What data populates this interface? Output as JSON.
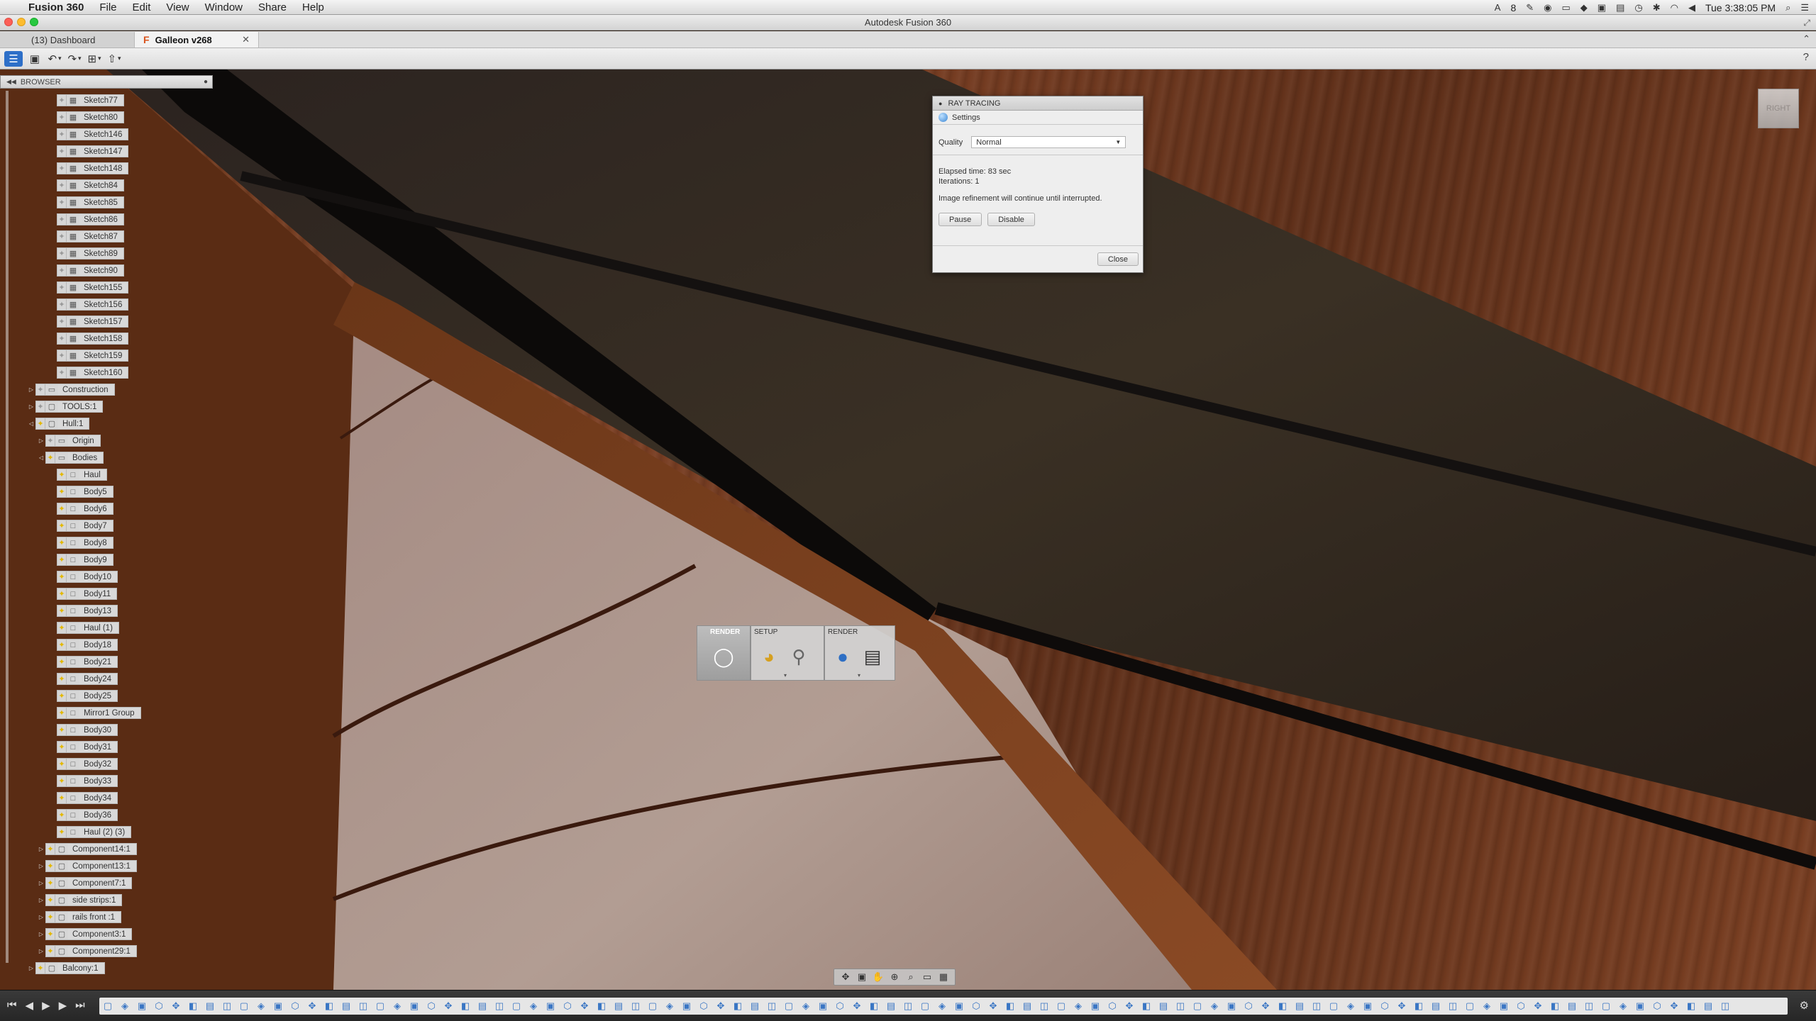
{
  "menubar": {
    "app_name": "Fusion 360",
    "items": [
      "File",
      "Edit",
      "View",
      "Window",
      "Share",
      "Help"
    ],
    "status": {
      "badge": "8",
      "clock": "Tue 3:38:05 PM"
    }
  },
  "window": {
    "title": "Autodesk Fusion 360"
  },
  "tabs": [
    {
      "label": "(13) Dashboard"
    },
    {
      "label": "Galleon v268"
    }
  ],
  "browser": {
    "title": "BROWSER",
    "nodes": [
      {
        "label": "Sketch77",
        "indent": 3,
        "type": "sketch",
        "bulb": "off"
      },
      {
        "label": "Sketch80",
        "indent": 3,
        "type": "sketch",
        "bulb": "off"
      },
      {
        "label": "Sketch146",
        "indent": 3,
        "type": "sketch",
        "bulb": "off"
      },
      {
        "label": "Sketch147",
        "indent": 3,
        "type": "sketch",
        "bulb": "off"
      },
      {
        "label": "Sketch148",
        "indent": 3,
        "type": "sketch",
        "bulb": "off"
      },
      {
        "label": "Sketch84",
        "indent": 3,
        "type": "sketch",
        "bulb": "off"
      },
      {
        "label": "Sketch85",
        "indent": 3,
        "type": "sketch",
        "bulb": "off"
      },
      {
        "label": "Sketch86",
        "indent": 3,
        "type": "sketch",
        "bulb": "off"
      },
      {
        "label": "Sketch87",
        "indent": 3,
        "type": "sketch",
        "bulb": "off"
      },
      {
        "label": "Sketch89",
        "indent": 3,
        "type": "sketch",
        "bulb": "off"
      },
      {
        "label": "Sketch90",
        "indent": 3,
        "type": "sketch",
        "bulb": "off"
      },
      {
        "label": "Sketch155",
        "indent": 3,
        "type": "sketch",
        "bulb": "off"
      },
      {
        "label": "Sketch156",
        "indent": 3,
        "type": "sketch",
        "bulb": "off"
      },
      {
        "label": "Sketch157",
        "indent": 3,
        "type": "sketch",
        "bulb": "off"
      },
      {
        "label": "Sketch158",
        "indent": 3,
        "type": "sketch",
        "bulb": "off"
      },
      {
        "label": "Sketch159",
        "indent": 3,
        "type": "sketch",
        "bulb": "off"
      },
      {
        "label": "Sketch160",
        "indent": 3,
        "type": "sketch",
        "bulb": "off"
      },
      {
        "label": "Construction",
        "indent": 1,
        "type": "folder",
        "bulb": "off",
        "expander": "▷"
      },
      {
        "label": "TOOLS:1",
        "indent": 1,
        "type": "component",
        "bulb": "off",
        "expander": "▷"
      },
      {
        "label": "Hull:1",
        "indent": 1,
        "type": "component",
        "bulb": "on",
        "expander": "◁"
      },
      {
        "label": "Origin",
        "indent": 2,
        "type": "folder",
        "bulb": "off",
        "expander": "▷"
      },
      {
        "label": "Bodies",
        "indent": 2,
        "type": "folder",
        "bulb": "on",
        "expander": "◁"
      },
      {
        "label": "Haul",
        "indent": 3,
        "type": "body",
        "bulb": "on"
      },
      {
        "label": "Body5",
        "indent": 3,
        "type": "body",
        "bulb": "on"
      },
      {
        "label": "Body6",
        "indent": 3,
        "type": "body",
        "bulb": "on"
      },
      {
        "label": "Body7",
        "indent": 3,
        "type": "body",
        "bulb": "on"
      },
      {
        "label": "Body8",
        "indent": 3,
        "type": "body",
        "bulb": "on"
      },
      {
        "label": "Body9",
        "indent": 3,
        "type": "body",
        "bulb": "on"
      },
      {
        "label": "Body10",
        "indent": 3,
        "type": "body",
        "bulb": "on"
      },
      {
        "label": "Body11",
        "indent": 3,
        "type": "body",
        "bulb": "on"
      },
      {
        "label": "Body13",
        "indent": 3,
        "type": "body",
        "bulb": "on"
      },
      {
        "label": "Haul (1)",
        "indent": 3,
        "type": "body",
        "bulb": "on"
      },
      {
        "label": "Body18",
        "indent": 3,
        "type": "body",
        "bulb": "on"
      },
      {
        "label": "Body21",
        "indent": 3,
        "type": "body",
        "bulb": "on"
      },
      {
        "label": "Body24",
        "indent": 3,
        "type": "body",
        "bulb": "on"
      },
      {
        "label": "Body25",
        "indent": 3,
        "type": "body",
        "bulb": "on"
      },
      {
        "label": "Mirror1 Group",
        "indent": 3,
        "type": "body",
        "bulb": "on"
      },
      {
        "label": "Body30",
        "indent": 3,
        "type": "body",
        "bulb": "on"
      },
      {
        "label": "Body31",
        "indent": 3,
        "type": "body",
        "bulb": "on"
      },
      {
        "label": "Body32",
        "indent": 3,
        "type": "body",
        "bulb": "on"
      },
      {
        "label": "Body33",
        "indent": 3,
        "type": "body",
        "bulb": "on"
      },
      {
        "label": "Body34",
        "indent": 3,
        "type": "body",
        "bulb": "on"
      },
      {
        "label": "Body36",
        "indent": 3,
        "type": "body",
        "bulb": "on"
      },
      {
        "label": "Haul (2) (3)",
        "indent": 3,
        "type": "body",
        "bulb": "on"
      },
      {
        "label": "Component14:1",
        "indent": 2,
        "type": "component",
        "bulb": "on",
        "expander": "▷"
      },
      {
        "label": "Component13:1",
        "indent": 2,
        "type": "component",
        "bulb": "on",
        "expander": "▷"
      },
      {
        "label": "Component7:1",
        "indent": 2,
        "type": "component",
        "bulb": "on",
        "expander": "▷"
      },
      {
        "label": "side strips:1",
        "indent": 2,
        "type": "component",
        "bulb": "on",
        "expander": "▷"
      },
      {
        "label": "rails front :1",
        "indent": 2,
        "type": "component",
        "bulb": "on",
        "expander": "▷"
      },
      {
        "label": "Component3:1",
        "indent": 2,
        "type": "component",
        "bulb": "on",
        "expander": "▷"
      },
      {
        "label": "Component29:1",
        "indent": 2,
        "type": "component",
        "bulb": "on",
        "expander": "▷"
      },
      {
        "label": "Balcony:1",
        "indent": 1,
        "type": "component",
        "bulb": "on",
        "expander": "▷"
      }
    ]
  },
  "ray_tracing": {
    "title": "RAY TRACING",
    "section": "Settings",
    "quality_label": "Quality",
    "quality_value": "Normal",
    "elapsed": "Elapsed time: 83 sec",
    "iterations": "Iterations: 1",
    "message": "Image refinement will continue until interrupted.",
    "pause_label": "Pause",
    "disable_label": "Disable",
    "close_label": "Close"
  },
  "render_toolbar": {
    "groups": [
      {
        "label": "RENDER"
      },
      {
        "label": "SETUP"
      },
      {
        "label": "RENDER"
      }
    ]
  },
  "viewcube": {
    "face": "RIGHT"
  }
}
